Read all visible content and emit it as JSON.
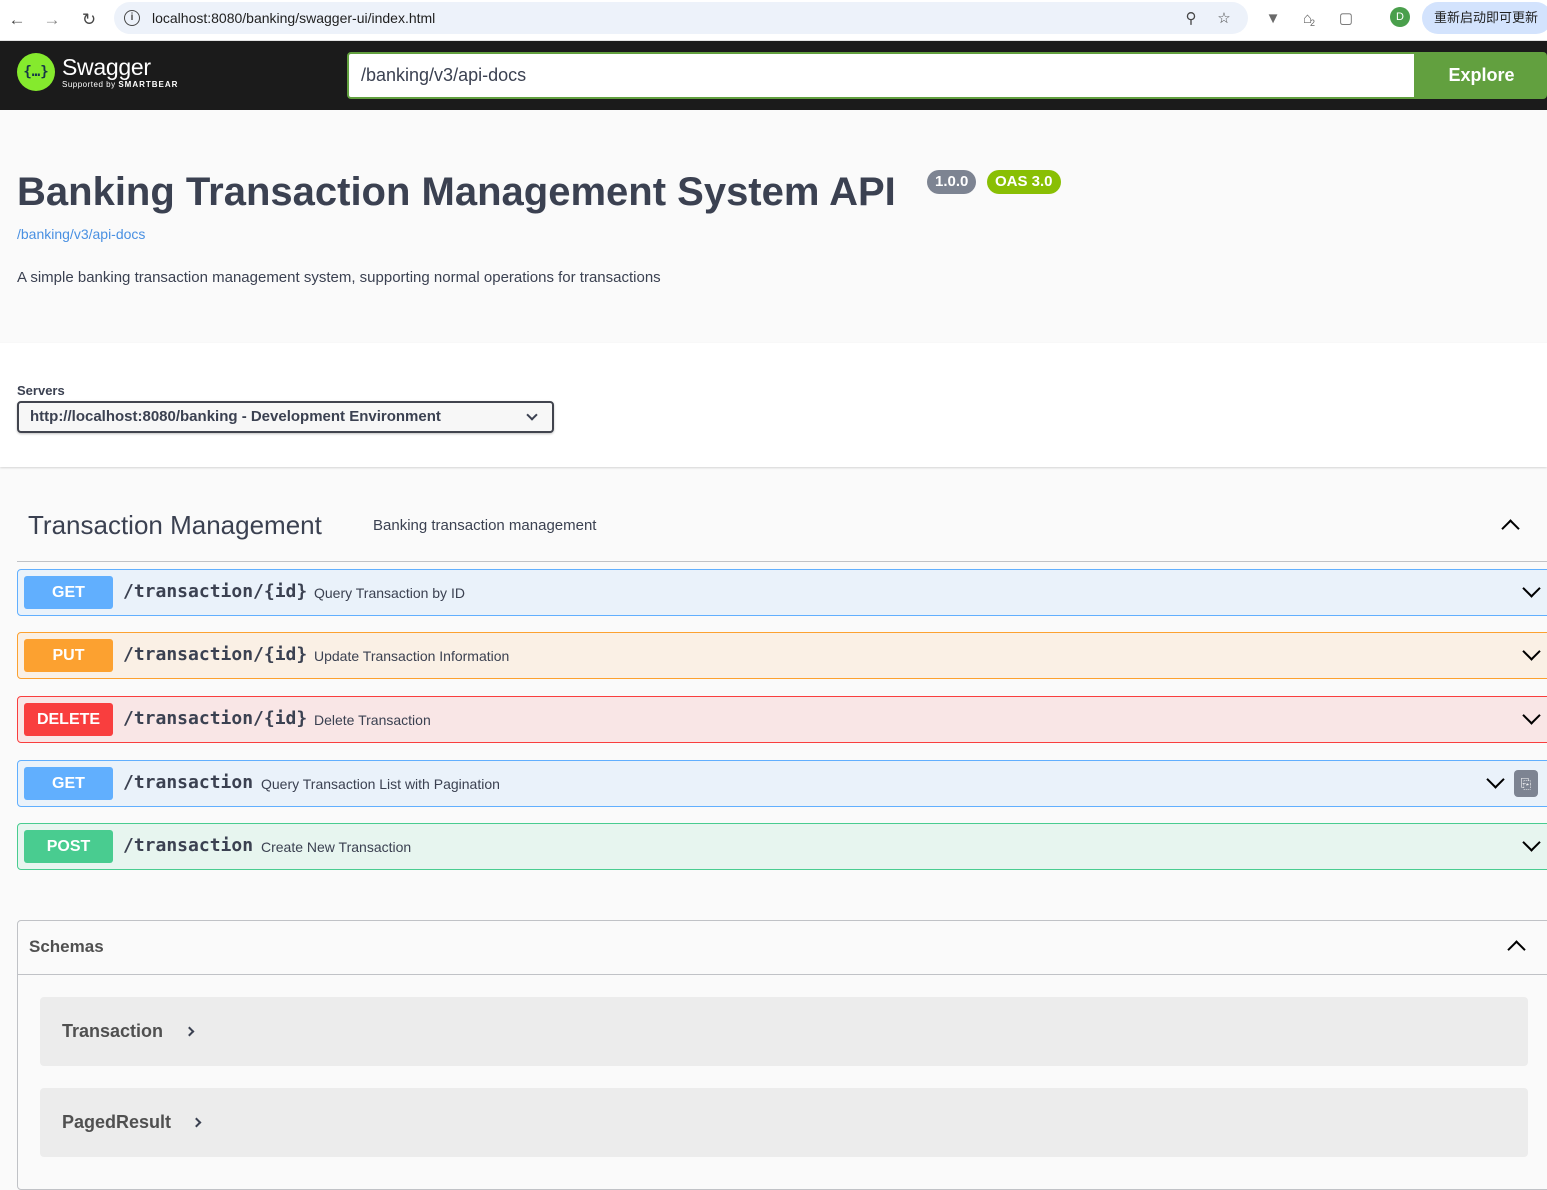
{
  "browser": {
    "url": "localhost:8080/banking/swagger-ui/index.html",
    "profile_initial": "D",
    "update_button": "重新启动即可更新",
    "ext_badge": "2"
  },
  "topbar": {
    "logo_title": "Swagger",
    "logo_supported": "Supported by",
    "logo_company": "SMARTBEAR",
    "spec_url": "/banking/v3/api-docs",
    "explore_label": "Explore"
  },
  "info": {
    "title": "Banking Transaction Management System API",
    "version": "1.0.0",
    "oas": "OAS 3.0",
    "spec_link": "/banking/v3/api-docs",
    "description": "A simple banking transaction management system, supporting normal operations for transactions"
  },
  "servers": {
    "label": "Servers",
    "selected": "http://localhost:8080/banking - Development Environment"
  },
  "tag": {
    "name": "Transaction Management",
    "description": "Banking transaction management"
  },
  "operations": [
    {
      "method": "GET",
      "path": "/transaction/{id}",
      "summary": "Query Transaction by ID"
    },
    {
      "method": "PUT",
      "path": "/transaction/{id}",
      "summary": "Update Transaction Information"
    },
    {
      "method": "DELETE",
      "path": "/transaction/{id}",
      "summary": "Delete Transaction"
    },
    {
      "method": "GET",
      "path": "/transaction",
      "summary": "Query Transaction List with Pagination"
    },
    {
      "method": "POST",
      "path": "/transaction",
      "summary": "Create New Transaction"
    }
  ],
  "schemas": {
    "title": "Schemas",
    "models": [
      "Transaction",
      "PagedResult"
    ]
  },
  "colors": {
    "get": "#61affe",
    "put": "#fca130",
    "delete": "#f93e3e",
    "post": "#49cc90",
    "explore": "#62a03f",
    "topbar": "#1b1b1b"
  },
  "icons": {
    "back": "arrow-left-icon",
    "forward": "arrow-right-icon",
    "reload": "reload-icon",
    "info": "site-info-icon",
    "zoom": "zoom-icon",
    "bookmark": "star-icon",
    "copy": "clipboard-icon"
  }
}
